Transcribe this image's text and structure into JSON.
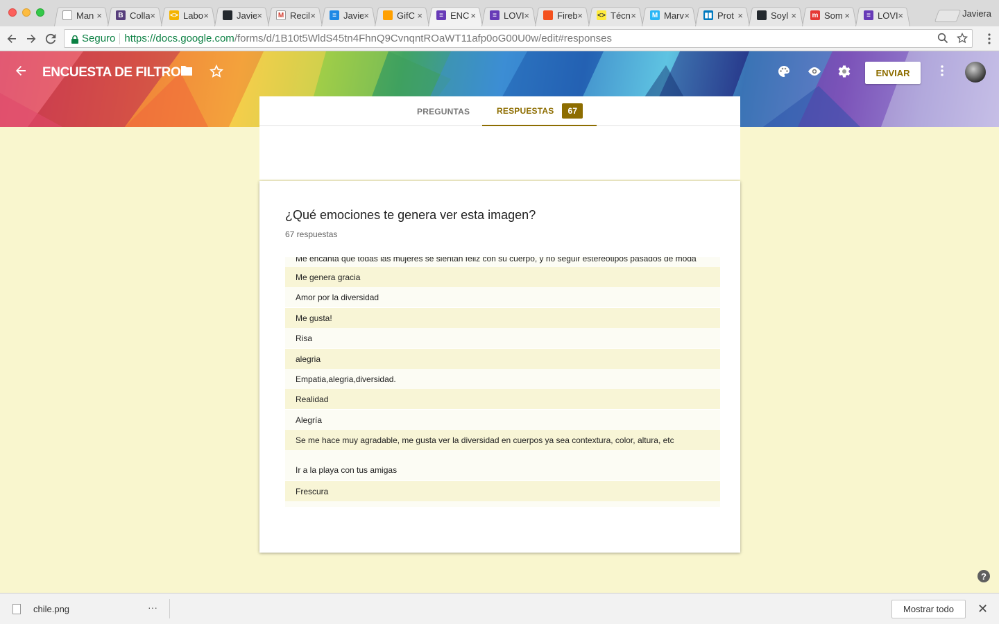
{
  "browser": {
    "profile_name": "Javiera",
    "tabs": [
      {
        "label": "Man",
        "color": "#ffffff",
        "icon": "document-icon",
        "glyph": ""
      },
      {
        "label": "Colla",
        "color": "#563d7c",
        "icon": "bootstrap-icon",
        "glyph": "B"
      },
      {
        "label": "Labo",
        "color": "#f4b400",
        "icon": "code-icon",
        "glyph": "<>"
      },
      {
        "label": "Javie",
        "color": "#24292e",
        "icon": "github-icon",
        "glyph": ""
      },
      {
        "label": "Recil",
        "color": "#ffffff",
        "icon": "gmail-icon",
        "glyph": "M"
      },
      {
        "label": "Javie",
        "color": "#1e88e5",
        "icon": "filter-icon",
        "glyph": "≡"
      },
      {
        "label": "GifC",
        "color": "#ffa000",
        "icon": "firebase-icon",
        "glyph": ""
      },
      {
        "label": "ENC",
        "color": "#673ab7",
        "icon": "forms-icon",
        "glyph": "≡",
        "active": true
      },
      {
        "label": "LOVI",
        "color": "#673ab7",
        "icon": "forms-icon",
        "glyph": "≡"
      },
      {
        "label": "Fireb",
        "color": "#f4511e",
        "icon": "firebase-icon",
        "glyph": ""
      },
      {
        "label": "Técn",
        "color": "#ffeb3b",
        "icon": "code-icon",
        "glyph": "<>"
      },
      {
        "label": "Marv",
        "color": "#29b6f6",
        "icon": "marvel-icon",
        "glyph": "M"
      },
      {
        "label": "Prot",
        "color": "#0079bf",
        "icon": "trello-icon",
        "glyph": "▮▮"
      },
      {
        "label": "Soyl",
        "color": "#24292e",
        "icon": "github-icon",
        "glyph": ""
      },
      {
        "label": "Som",
        "color": "#e53935",
        "icon": "medium-icon",
        "glyph": "m"
      },
      {
        "label": "LOVI",
        "color": "#673ab7",
        "icon": "forms-icon",
        "glyph": "≡"
      }
    ],
    "tab_close": "×",
    "secure_label": "Seguro",
    "url_host": "https://docs.google.com",
    "url_path": "/forms/d/1B10t5WldS45tn4FhnQ9CvnqntROaWT11afp0oG00U0w/edit#responses"
  },
  "header": {
    "title": "ENCUESTA DE FILTRO",
    "send_label": "ENVIAR"
  },
  "form_tabs": {
    "questions": "PREGUNTAS",
    "responses": "RESPUESTAS",
    "responses_count": "67"
  },
  "card": {
    "question": "¿Qué emociones te genera ver esta imagen?",
    "response_count": "67 respuestas",
    "responses": [
      "Me encanta que todas las mujeres se sientan feliz con su cuerpo, y no seguir estereotipos pasados de moda",
      "Me genera gracia",
      "Amor por la diversidad",
      "Me gusta!",
      "Risa",
      "alegria",
      "Empatia,alegria,diversidad.",
      "Realidad",
      "Alegría",
      "Se me hace muy agradable, me gusta ver la diversidad en cuerpos ya sea contextura, color, altura, etc",
      "",
      "Ir a la playa con tus amigas",
      "Frescura"
    ]
  },
  "downloads": {
    "file_name": "chile.png",
    "more": "···",
    "show_all": "Mostrar todo",
    "close": "✕"
  },
  "help": "?",
  "colors": {
    "accent": "#8d6d00",
    "page_bg": "#f9f6ce"
  }
}
